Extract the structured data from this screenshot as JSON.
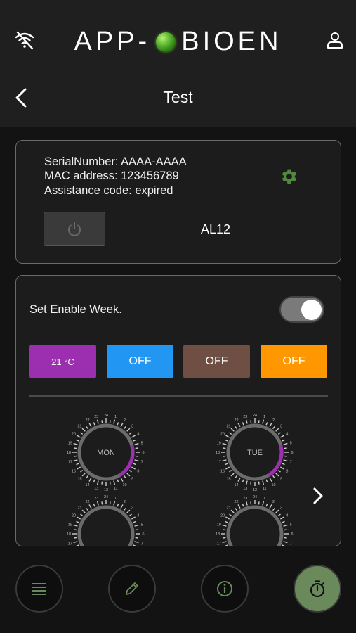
{
  "header": {
    "brand_left": "APP-",
    "brand_right": "BIOEN",
    "page_title": "Test"
  },
  "device": {
    "serial": "SerialNumber: AAAA-AAAA",
    "mac": "MAC address: 123456789",
    "assistance": "Assistance code: expired",
    "name": "AL12"
  },
  "week": {
    "enable_label": "Set Enable Week.",
    "enabled": true,
    "modes": [
      {
        "label": "21 °C",
        "color": "#9b2fb0"
      },
      {
        "label": "OFF",
        "color": "#2196f3"
      },
      {
        "label": "OFF",
        "color": "#6f4f43"
      },
      {
        "label": "OFF",
        "color": "#ff9800"
      }
    ],
    "days": [
      "MON",
      "TUE"
    ]
  },
  "colors": {
    "accent_green": "#6b8a5c",
    "gear_green": "#4e8a3a"
  }
}
